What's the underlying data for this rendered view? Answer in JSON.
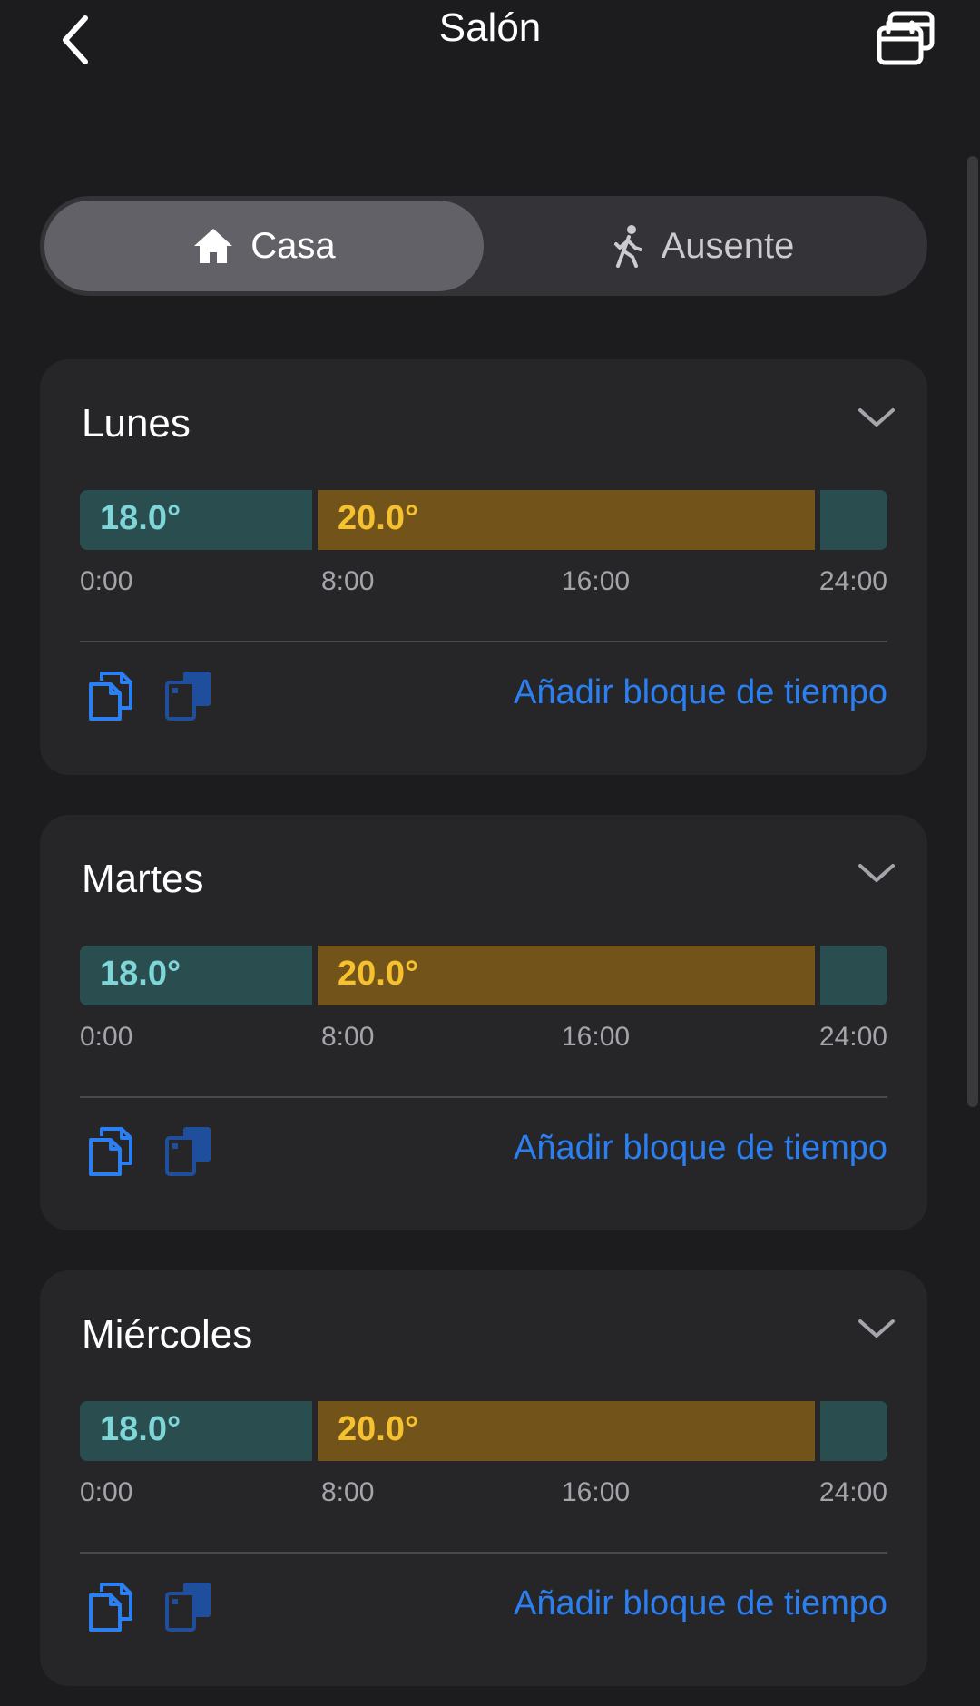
{
  "header": {
    "title": "Salón",
    "back_icon": "chevron-left-icon",
    "calendar_icon": "calendar-copy-icon"
  },
  "mode_toggle": {
    "options": [
      {
        "label": "Casa",
        "icon": "home-icon",
        "selected": true
      },
      {
        "label": "Ausente",
        "icon": "walking-person-icon",
        "selected": false
      }
    ]
  },
  "colors": {
    "background": "#1c1c1f",
    "card": "#262629",
    "low_temp": "#2a4e50",
    "low_temp_text": "#7ed6d8",
    "high_temp": "#72541a",
    "high_temp_text": "#f5c12e",
    "accent": "#2b7ff0"
  },
  "days": [
    {
      "name": "Lunes",
      "blocks": [
        {
          "label": "18.0°",
          "start": "0:00",
          "end": "6:45"
        },
        {
          "label": "20.0°",
          "start": "6:45",
          "end": "22:00"
        },
        {
          "label": "",
          "start": "22:00",
          "end": "24:00"
        }
      ],
      "ticks": [
        "0:00",
        "8:00",
        "16:00",
        "24:00"
      ],
      "add_label": "Añadir bloque de tiempo"
    },
    {
      "name": "Martes",
      "blocks": [
        {
          "label": "18.0°",
          "start": "0:00",
          "end": "6:45"
        },
        {
          "label": "20.0°",
          "start": "6:45",
          "end": "22:00"
        },
        {
          "label": "",
          "start": "22:00",
          "end": "24:00"
        }
      ],
      "ticks": [
        "0:00",
        "8:00",
        "16:00",
        "24:00"
      ],
      "add_label": "Añadir bloque de tiempo"
    },
    {
      "name": "Miércoles",
      "blocks": [
        {
          "label": "18.0°",
          "start": "0:00",
          "end": "6:45"
        },
        {
          "label": "20.0°",
          "start": "6:45",
          "end": "22:00"
        },
        {
          "label": "",
          "start": "22:00",
          "end": "24:00"
        }
      ],
      "ticks": [
        "0:00",
        "8:00",
        "16:00",
        "24:00"
      ],
      "add_label": "Añadir bloque de tiempo"
    }
  ]
}
